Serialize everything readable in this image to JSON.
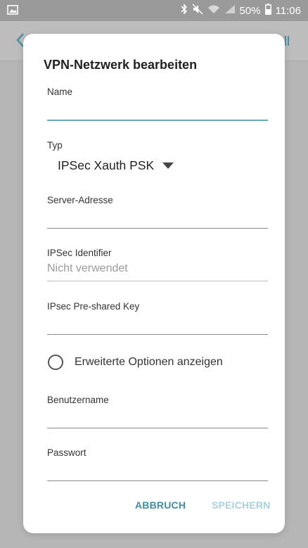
{
  "status_bar": {
    "battery": "50%",
    "time": "11:06",
    "icons": [
      "image-icon",
      "bluetooth-icon",
      "mute-icon",
      "wifi-icon",
      "signal-icon",
      "battery-icon"
    ]
  },
  "dialog": {
    "title": "VPN-Netzwerk bearbeiten",
    "fields": {
      "name": {
        "label": "Name",
        "value": ""
      },
      "type": {
        "label": "Typ",
        "value": "IPSec Xauth PSK"
      },
      "server": {
        "label": "Server-Adresse",
        "value": ""
      },
      "ipsec_identifier": {
        "label": "IPSec Identifier",
        "placeholder": "Nicht verwendet",
        "value": ""
      },
      "psk": {
        "label": "IPsec Pre-shared Key",
        "value": ""
      },
      "advanced": {
        "label": "Erweiterte Optionen anzeigen",
        "checked": false
      },
      "username": {
        "label": "Benutzername",
        "value": ""
      },
      "password": {
        "label": "Passwort",
        "value": ""
      }
    },
    "buttons": {
      "cancel": "ABBRUCH",
      "save": "SPEICHERN"
    }
  },
  "colors": {
    "accent": "#3f8ea4",
    "accent_disabled": "#a9d0dc",
    "active_underline": "#6aa9b8"
  }
}
